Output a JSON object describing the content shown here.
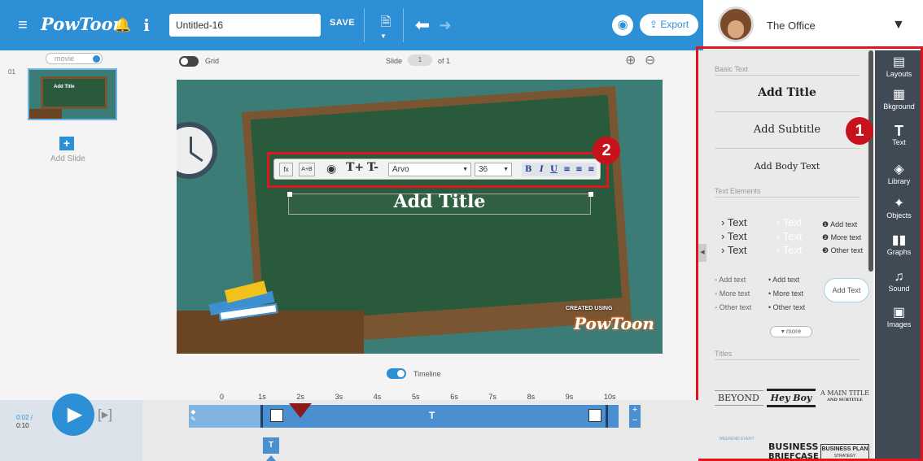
{
  "header": {
    "logo": "PowToon",
    "title_value": "Untitled-16",
    "save_label": "SAVE",
    "export_label": "Export"
  },
  "profile": {
    "name": "The Office"
  },
  "left": {
    "mode_label": "movie",
    "slide_number": "01",
    "thumb_title": "Add Title",
    "add_slide_label": "Add Slide"
  },
  "canvas": {
    "grid_label": "Grid",
    "slide_label": "Slide",
    "slide_value": "1",
    "slide_of": "of 1",
    "title_text": "Add Title",
    "watermark_top": "CREATED USING",
    "watermark_logo": "PowToon"
  },
  "text_toolbar": {
    "fx": "fx",
    "ab": "A+B",
    "font": "Arvo",
    "size": "36",
    "bold": "B",
    "italic": "I",
    "underline": "U"
  },
  "badges": {
    "one": "1",
    "two": "2"
  },
  "right_panel": {
    "basic_text_title": "Basic Text",
    "add_title": "Add Title",
    "add_subtitle": "Add Subtitle",
    "add_body": "Add Body Text",
    "text_elements_title": "Text Elements",
    "arrow_items": [
      "› Text",
      "› Text",
      "› Text"
    ],
    "faded_items": [
      "› Text",
      "› Text",
      "› Text"
    ],
    "numbered_items": [
      "Add text",
      "More text",
      "Other text"
    ],
    "bullet_a": [
      "◦ Add text",
      "◦ More text",
      "◦ Other text"
    ],
    "bullet_b": [
      "• Add text",
      "• More text",
      "• Other text"
    ],
    "bubble_text": "Add Text",
    "more_label": "▾ more",
    "titles_title": "Titles",
    "title_styles": [
      "BEYOND",
      "Hey Boy",
      "A MAIN TITLE",
      "AND SUBTITLE"
    ],
    "title_styles_2": [
      "WEEKEND EVENT",
      "BUSINESS",
      "BRIEFCASE",
      "BUSINESS PLAN",
      "STRATEGY"
    ]
  },
  "rail": [
    {
      "label": "Layouts",
      "icon": "layout-icon"
    },
    {
      "label": "Bkground",
      "icon": "background-icon"
    },
    {
      "label": "Text",
      "icon": "text-icon"
    },
    {
      "label": "Library",
      "icon": "library-icon"
    },
    {
      "label": "Objects",
      "icon": "objects-icon"
    },
    {
      "label": "Graphs",
      "icon": "graphs-icon"
    },
    {
      "label": "Sound",
      "icon": "sound-icon"
    },
    {
      "label": "Images",
      "icon": "images-icon"
    }
  ],
  "timeline": {
    "toggle_label": "Timeline",
    "time_current": "0:02 /",
    "time_total": "0:10",
    "ticks": [
      "0",
      "1s",
      "2s",
      "3s",
      "4s",
      "5s",
      "6s",
      "7s",
      "8s",
      "9s",
      "10s"
    ],
    "track_label": "T"
  },
  "help_label": "?",
  "colors": {
    "accent": "#2d8fd6",
    "highlight": "#e0161f",
    "rail": "#3f4a55",
    "chalkboard": "#2a5a3c"
  }
}
